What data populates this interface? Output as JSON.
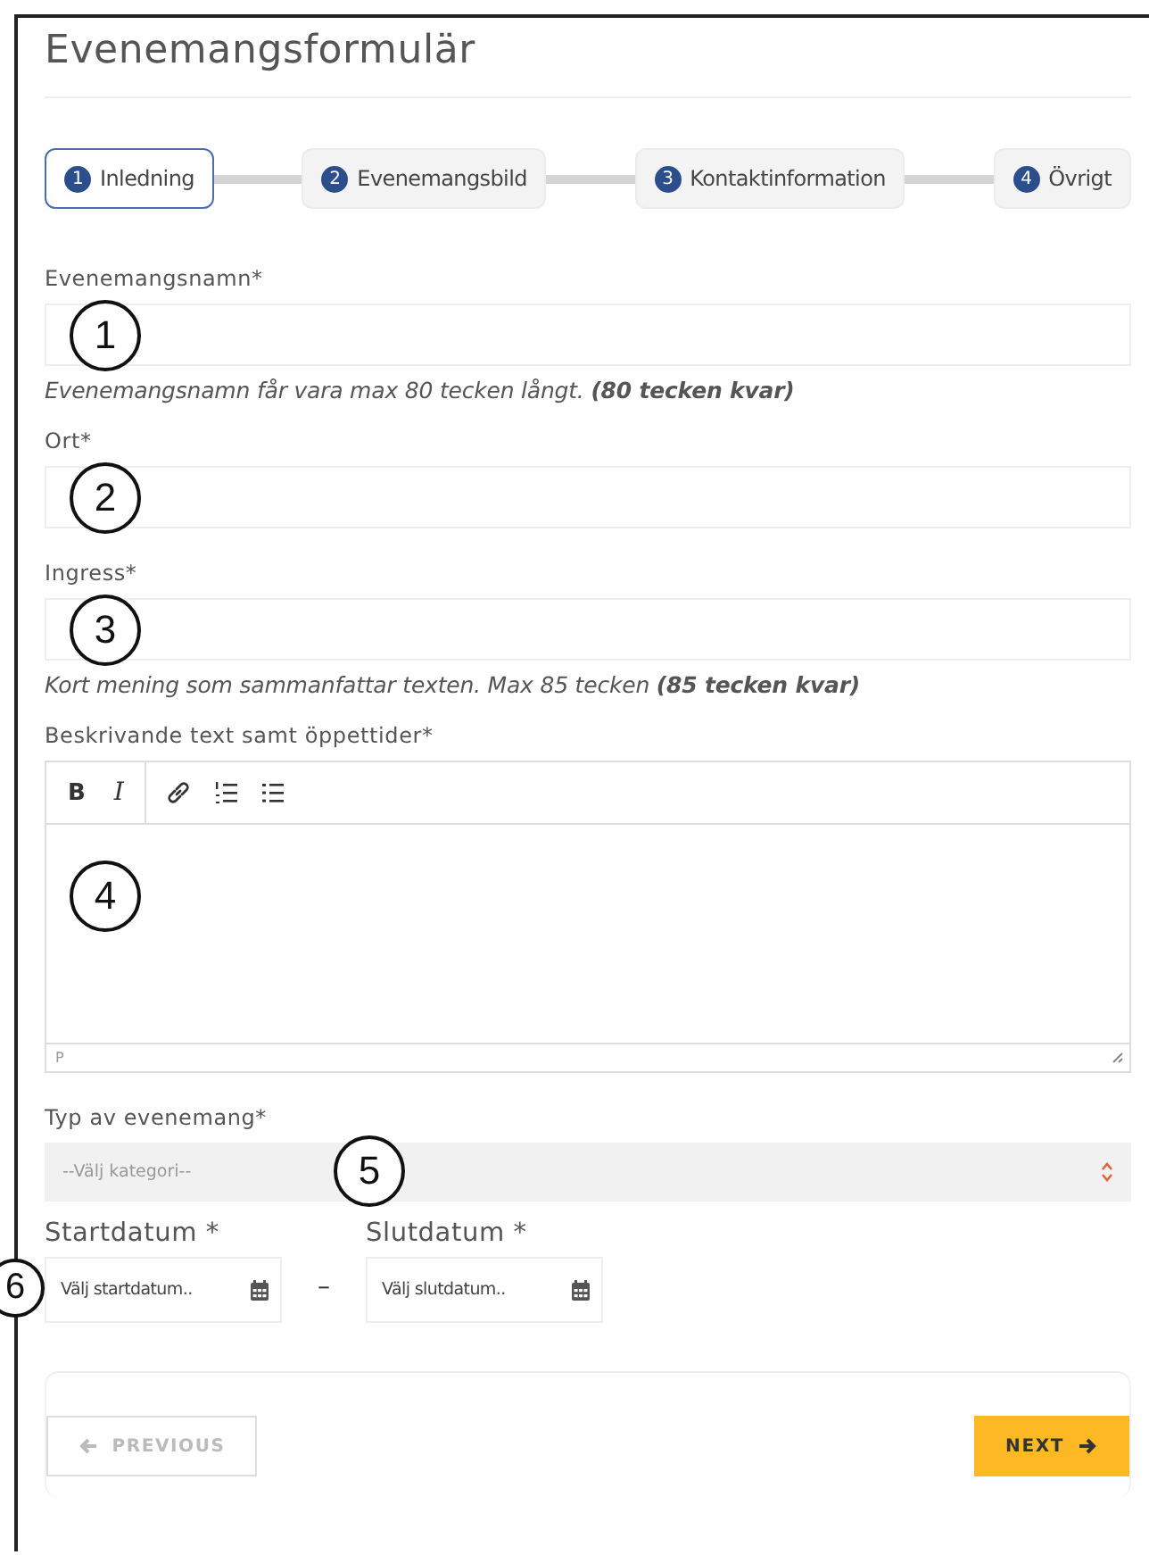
{
  "title": "Evenemangsformulär",
  "steps": [
    {
      "number": "1",
      "label": "Inledning",
      "selected": true
    },
    {
      "number": "2",
      "label": "Evenemangsbild",
      "selected": false
    },
    {
      "number": "3",
      "label": "Kontaktinformation",
      "selected": false
    },
    {
      "number": "4",
      "label": "Övrigt",
      "selected": false
    }
  ],
  "fields": [
    {
      "kind": "text",
      "label": "Evenemangsnamn*",
      "callout": "1",
      "help": "Evenemangsnamn får vara max 80 tecken långt. **(80 tecken kvar)**"
    },
    {
      "kind": "text",
      "label": "Ort*",
      "callout": "2"
    },
    {
      "kind": "text",
      "label": "Ingress*",
      "callout": "3",
      "help": "Kort mening som sammanfattar texten. Max 85 tecken **(85 tecken kvar)**"
    },
    {
      "kind": "editor",
      "label": "Beskrivande text samt öppettider*",
      "callout": "4",
      "toolbar": [
        "B",
        "I"
      ],
      "status": "P"
    },
    {
      "kind": "select",
      "label": "Typ av evenemang*",
      "callout": "5",
      "placeholder": "--Välj kategori--"
    }
  ],
  "dates": {
    "callout": "6",
    "start": {
      "label": "Startdatum *",
      "placeholder": "Välj startdatum.."
    },
    "separator": "–",
    "end": {
      "label": "Slutdatum *",
      "placeholder": "Välj slutdatum.."
    }
  },
  "buttons": {
    "previous": {
      "label": "PREVIOUS",
      "disabled": true
    },
    "next": {
      "label": "NEXT"
    }
  }
}
